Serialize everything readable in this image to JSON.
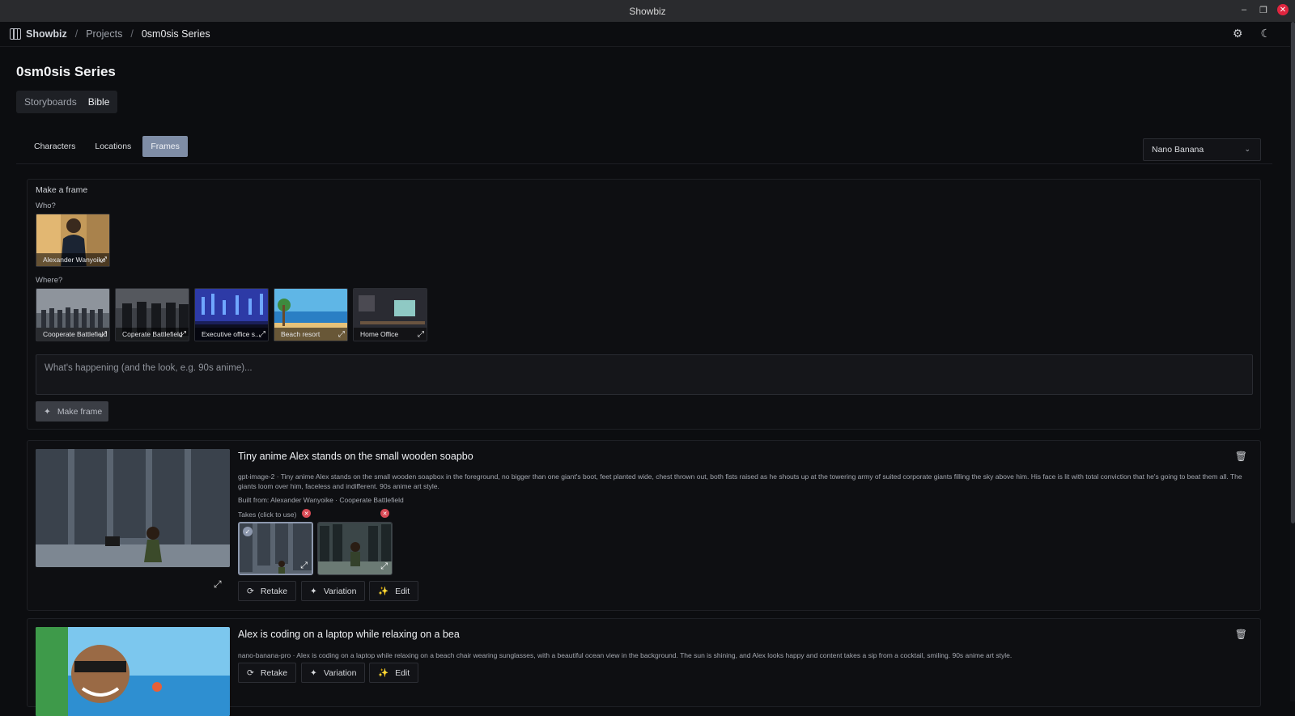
{
  "window": {
    "title": "Showbiz"
  },
  "breadcrumb": {
    "app": "Showbiz",
    "projects": "Projects",
    "current": "0sm0sis Series"
  },
  "page": {
    "title": "0sm0sis Series"
  },
  "mode_tabs": [
    {
      "label": "Storyboards"
    },
    {
      "label": "Bible"
    }
  ],
  "sub_tabs": [
    {
      "label": "Characters"
    },
    {
      "label": "Locations"
    },
    {
      "label": "Frames"
    }
  ],
  "model_select": {
    "value": "Nano Banana"
  },
  "make_frame": {
    "heading": "Make a frame",
    "who_label": "Who?",
    "who": [
      {
        "name": "Alexander Wanyoike"
      }
    ],
    "where_label": "Where?",
    "where": [
      {
        "name": "Cooperate Battlefield"
      },
      {
        "name": "Coperate Battlefield"
      },
      {
        "name": "Executive office s..."
      },
      {
        "name": "Beach resort"
      },
      {
        "name": "Home Office"
      }
    ],
    "prompt_placeholder": "What's happening (and the look, e.g. 90s anime)...",
    "button_label": "Make frame"
  },
  "frames": [
    {
      "title": "Tiny anime Alex stands on the small wooden soapbo",
      "description": "gpt-image-2 · Tiny anime Alex stands on the small wooden soapbox in the foreground, no bigger than one giant's boot, feet planted wide, chest thrown out, both fists raised as he shouts up at the towering army of suited corporate giants filling the sky above him. His face is lit with total conviction that he's going to beat them all. The giants loom over him, faceless and indifferent. 90s anime art style.",
      "built_from": "Built from: Alexander Wanyoike · Cooperate Battlefield",
      "takes_label": "Takes (click to use)",
      "actions": [
        "Retake",
        "Variation",
        "Edit"
      ]
    },
    {
      "title": "Alex is coding on a laptop while relaxing on a bea",
      "description": "nano-banana-pro · Alex is coding on a laptop while relaxing on a beach chair wearing sunglasses, with a beautiful ocean view in the background. The sun is shining, and Alex looks happy and content takes a sip from a cocktail, smiling. 90s anime art style.",
      "actions": [
        "Retake",
        "Variation",
        "Edit"
      ]
    }
  ],
  "colors": {
    "accent": "#7f8da6",
    "background": "#0c0d10",
    "danger": "#d94a55"
  }
}
